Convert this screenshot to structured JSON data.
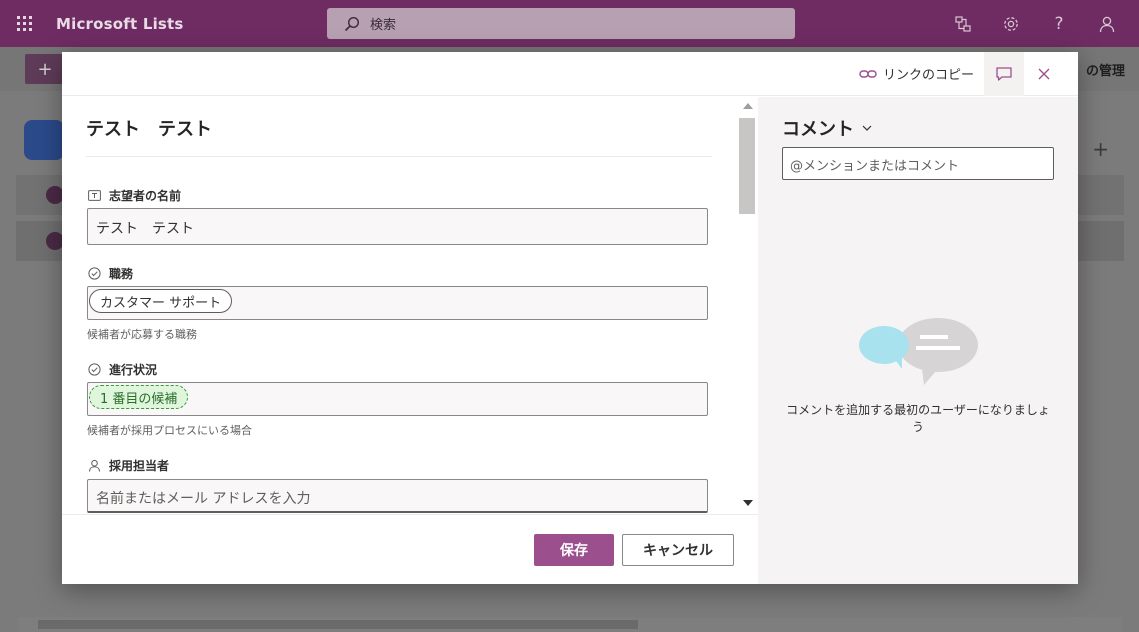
{
  "app": {
    "title": "Microsoft Lists",
    "search_placeholder": "検索"
  },
  "background": {
    "manage_label": "の管理"
  },
  "modal": {
    "copy_link_label": "リンクのコピー",
    "form": {
      "title": "テスト　テスト",
      "fields": [
        {
          "label": "志望者の名前",
          "icon": "text-field-icon",
          "value": "テスト　テスト"
        },
        {
          "label": "職務",
          "icon": "choice-icon",
          "value": "カスタマー サポート",
          "description": "候補者が応募する職務"
        },
        {
          "label": "進行状況",
          "icon": "choice-icon",
          "value": "1 番目の候補",
          "description": "候補者が採用プロセスにいる場合"
        },
        {
          "label": "採用担当者",
          "icon": "person-icon",
          "placeholder": "名前またはメール アドレスを入力"
        }
      ]
    },
    "footer": {
      "save_label": "保存",
      "cancel_label": "キャンセル"
    },
    "comments": {
      "title": "コメント",
      "input_placeholder": "@メンションまたはコメント",
      "empty_message": "コメントを追加する最初のユーザーになりましょう"
    }
  },
  "colors": {
    "app_bar": "#6e2c63",
    "primary_button": "#9b4f8c",
    "status_pill_bg": "#dff6dd",
    "status_pill_border": "#3a9a3a"
  }
}
